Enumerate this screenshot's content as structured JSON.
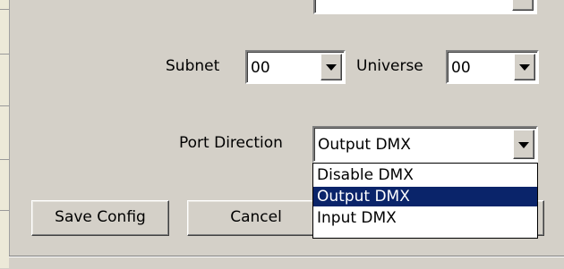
{
  "network": {
    "subnet_label": "Subnet",
    "subnet_value": "00",
    "universe_label": "Universe",
    "universe_value": "00"
  },
  "port": {
    "direction_label": "Port Direction",
    "direction_value": "Output DMX",
    "options": [
      "Disable DMX",
      "Output DMX",
      "Input DMX"
    ],
    "selected_index": 1
  },
  "buttons": {
    "save_label": "Save Config",
    "cancel_label": "Cancel"
  },
  "colors": {
    "window_bg": "#d4d0c8",
    "selection_bg": "#0a246a",
    "selection_fg": "#ffffff"
  },
  "icons": {
    "dropdown": "chevron-down-icon"
  }
}
